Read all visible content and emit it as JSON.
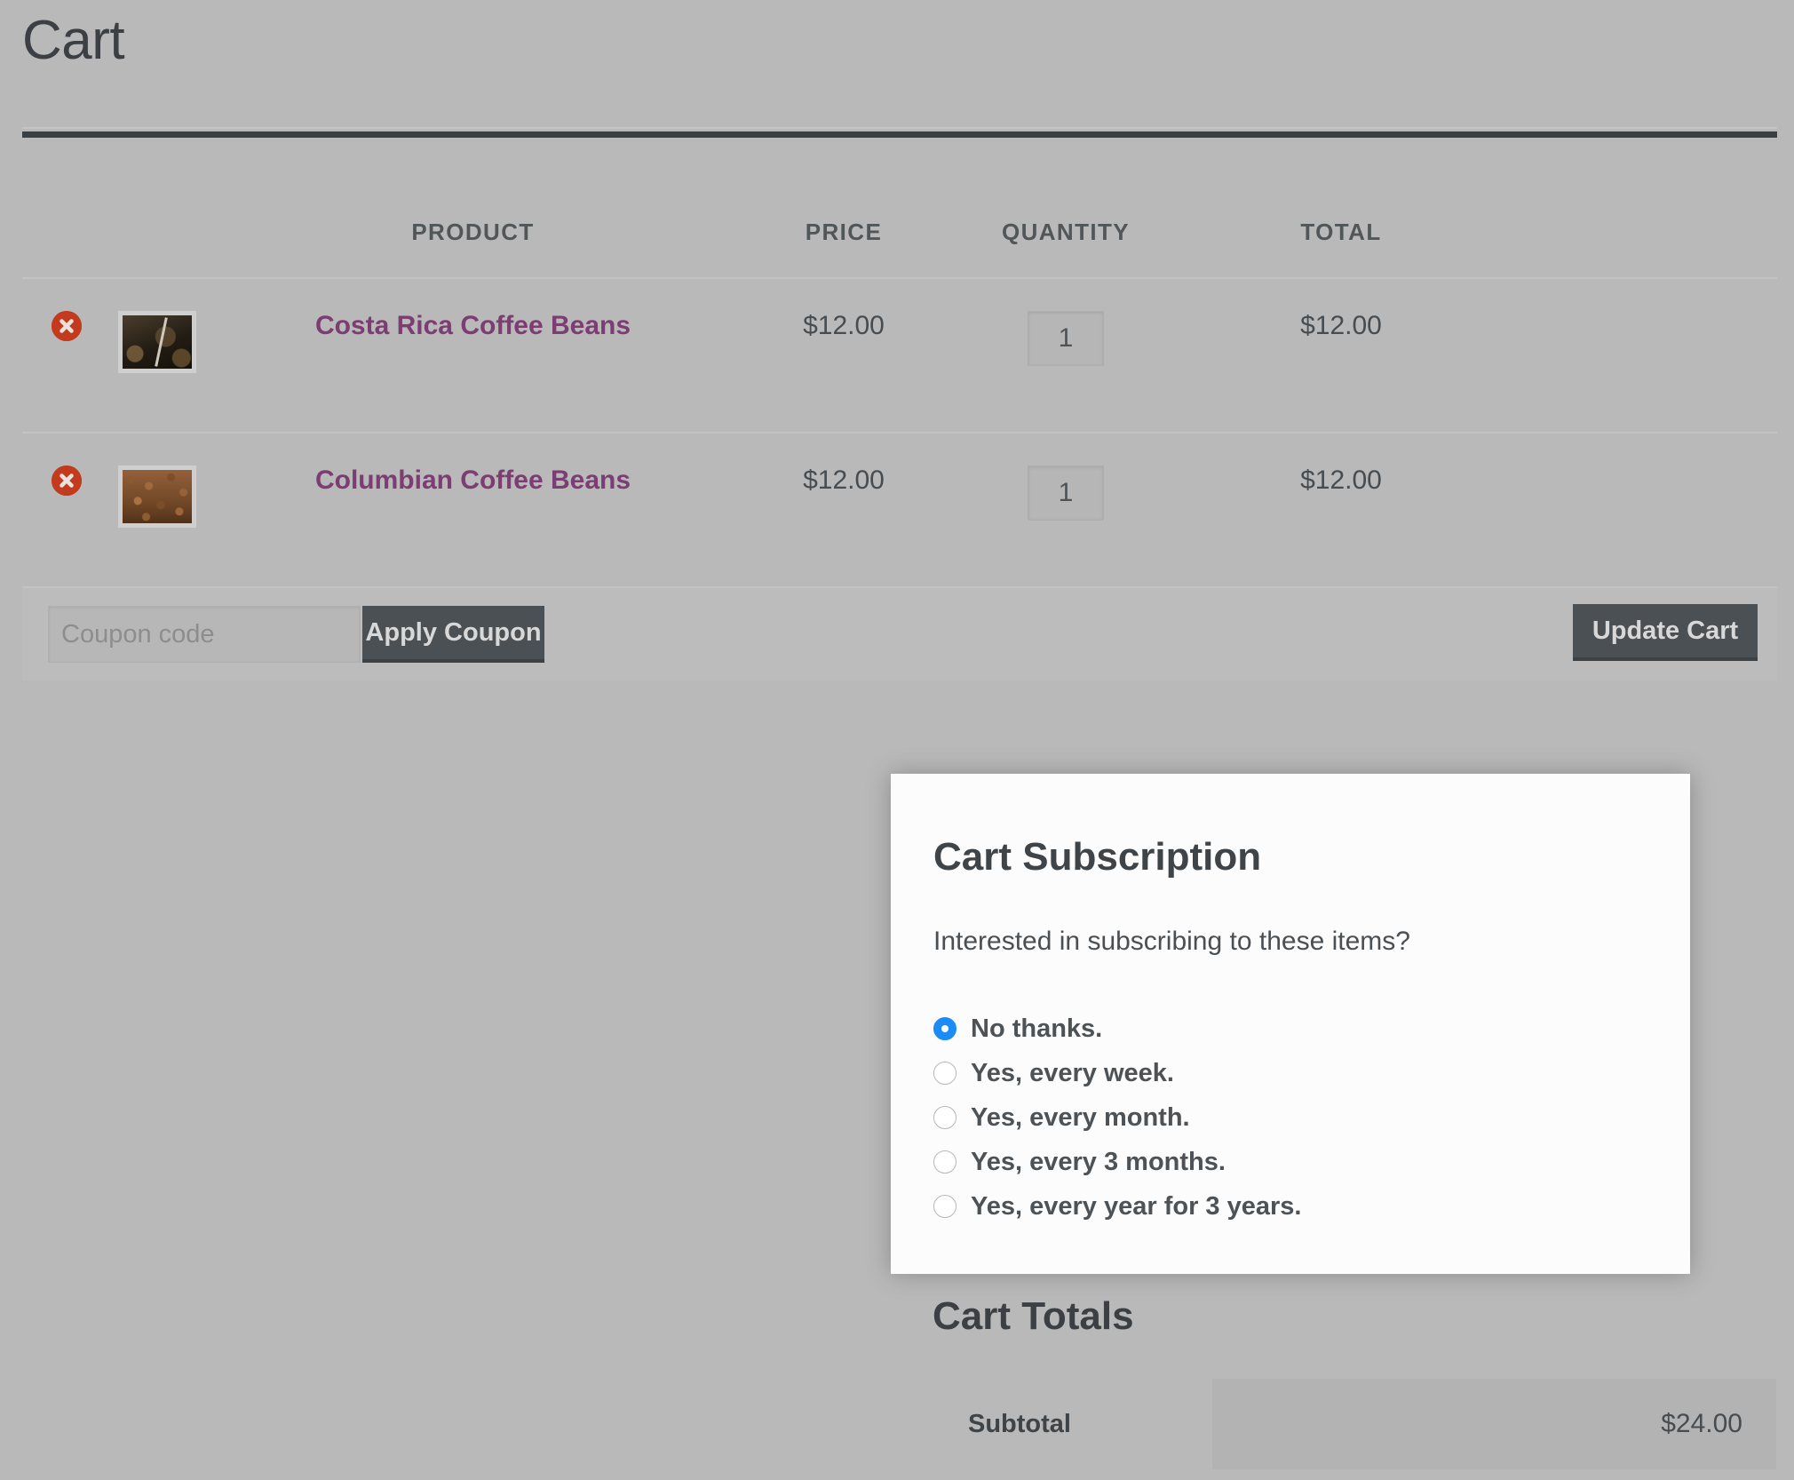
{
  "page": {
    "title": "Cart"
  },
  "cart_table": {
    "columns": [
      {
        "key": "remove",
        "label": ""
      },
      {
        "key": "thumb",
        "label": ""
      },
      {
        "key": "product",
        "label": "PRODUCT"
      },
      {
        "key": "price",
        "label": "PRICE"
      },
      {
        "key": "quantity",
        "label": "QUANTITY"
      },
      {
        "key": "total",
        "label": "TOTAL"
      }
    ],
    "rows": [
      {
        "remove_icon": "remove-circle-x-icon",
        "thumb_icon": "coffee-beans-dark-thumbnail",
        "product": "Costa Rica Coffee Beans",
        "price": "$12.00",
        "quantity": "1",
        "total": "$12.00"
      },
      {
        "remove_icon": "remove-circle-x-icon",
        "thumb_icon": "coffee-beans-roasted-thumbnail",
        "product": "Columbian Coffee Beans",
        "price": "$12.00",
        "quantity": "1",
        "total": "$12.00"
      }
    ]
  },
  "coupon": {
    "placeholder": "Coupon code",
    "value": "",
    "apply_label": "Apply Coupon",
    "update_label": "Update Cart"
  },
  "cart_totals": {
    "title": "Cart Totals",
    "rows": [
      {
        "label": "Subtotal",
        "value": "$24.00"
      }
    ]
  },
  "subscription_modal": {
    "title": "Cart Subscription",
    "subtitle": "Interested in subscribing to these items?",
    "selected_index": 0,
    "options": [
      {
        "label": "No thanks."
      },
      {
        "label": "Yes, every week."
      },
      {
        "label": "Yes, every month."
      },
      {
        "label": "Yes, every 3 months."
      },
      {
        "label": "Yes, every year for 3 years."
      }
    ]
  },
  "colors": {
    "page_background": "#b9b9b9",
    "accent_link": "#7b3d72",
    "remove_icon": "#c23b1e",
    "button": "#4b5054",
    "radio_selected": "#1b8cf5",
    "heading": "#3c4044"
  }
}
